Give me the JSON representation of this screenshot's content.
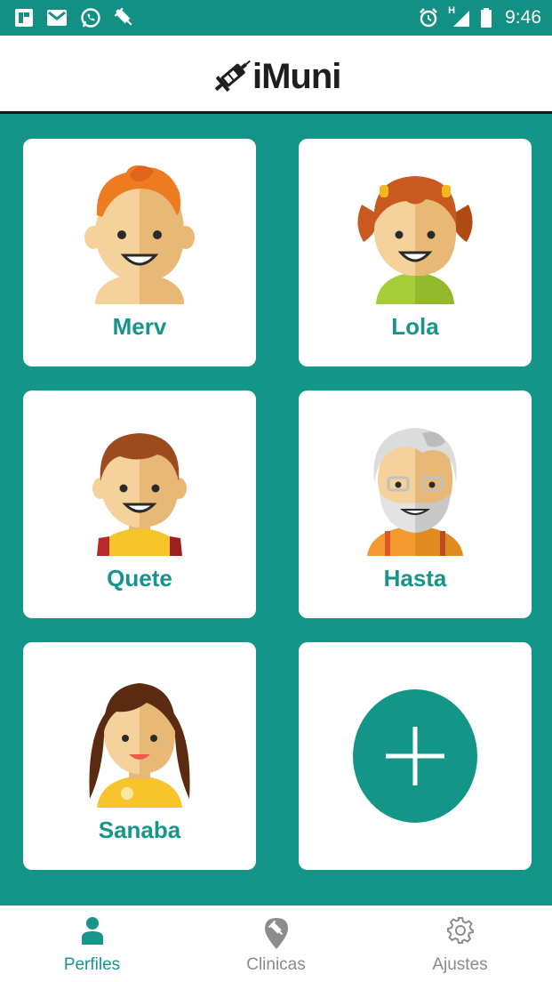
{
  "status_bar": {
    "time": "9:46",
    "network": "H",
    "icons_left": [
      "flipboard-icon",
      "gmail-icon",
      "whatsapp-icon",
      "syringe-icon"
    ],
    "icons_right": [
      "alarm-icon",
      "signal-icon",
      "battery-icon"
    ]
  },
  "header": {
    "app_name": "iMuni",
    "logo_icon": "syringe-icon"
  },
  "profiles": [
    {
      "name": "Merv",
      "avatar": "baby-avatar"
    },
    {
      "name": "Lola",
      "avatar": "girl-avatar"
    },
    {
      "name": "Quete",
      "avatar": "boy-avatar"
    },
    {
      "name": "Hasta",
      "avatar": "grandpa-avatar"
    },
    {
      "name": "Sanaba",
      "avatar": "woman-avatar"
    }
  ],
  "add_profile": {
    "icon": "plus-icon"
  },
  "bottom_nav": {
    "items": [
      {
        "label": "Perfiles",
        "icon": "person-icon",
        "active": true
      },
      {
        "label": "Clinicas",
        "icon": "map-pin-syringe-icon",
        "active": false
      },
      {
        "label": "Ajustes",
        "icon": "gear-icon",
        "active": false
      }
    ]
  },
  "colors": {
    "primary": "#139688",
    "status_bar": "#139084",
    "accent_text": "#17958a",
    "inactive_text": "#8a8a8a"
  }
}
